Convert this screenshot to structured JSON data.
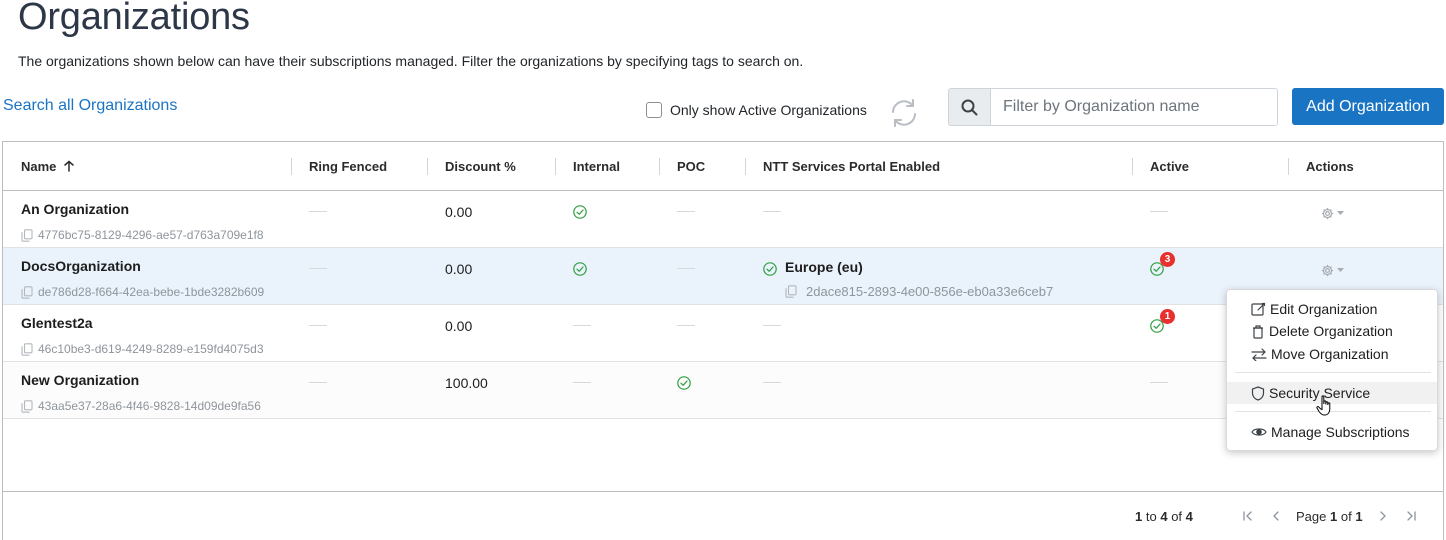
{
  "page": {
    "title": "Organizations",
    "description": "The organizations shown below can have their subscriptions managed. Filter the organizations by specifying tags to search on."
  },
  "toolbar": {
    "search_all_link": "Search all Organizations",
    "active_only_label": "Only show Active Organizations",
    "active_only_checked": false,
    "filter_placeholder": "Filter by Organization name",
    "add_button": "Add Organization"
  },
  "grid": {
    "columns": [
      "Name",
      "Ring Fenced",
      "Discount %",
      "Internal",
      "POC",
      "NTT Services Portal Enabled",
      "Active",
      "Actions"
    ],
    "sort": {
      "column": "Name",
      "direction": "ascending"
    },
    "rows": [
      {
        "name": "An Organization",
        "id": "4776bc75-8129-4296-ae57-d763a709e1f8",
        "ring_fenced": false,
        "discount": "0.00",
        "internal": true,
        "poc": false,
        "portal_region": "",
        "portal_id": "",
        "active": false,
        "active_badge": ""
      },
      {
        "name": "DocsOrganization",
        "id": "de786d28-f664-42ea-bebe-1bde3282b609",
        "ring_fenced": false,
        "discount": "0.00",
        "internal": true,
        "poc": false,
        "portal_region": "Europe (eu)",
        "portal_id": "2dace815-2893-4e00-856e-eb0a33e6ceb7",
        "active": true,
        "active_badge": "3"
      },
      {
        "name": "Glentest2a",
        "id": "46c10be3-d619-4249-8289-e159fd4075d3",
        "ring_fenced": false,
        "discount": "0.00",
        "internal": false,
        "poc": false,
        "portal_region": "",
        "portal_id": "",
        "active": true,
        "active_badge": "1"
      },
      {
        "name": "New Organization",
        "id": "43aa5e37-28a6-4f46-9828-14d09de9fa56",
        "ring_fenced": false,
        "discount": "100.00",
        "internal": false,
        "poc": true,
        "portal_region": "",
        "portal_id": "",
        "active": false,
        "active_badge": ""
      }
    ]
  },
  "pagination": {
    "range_start": "1",
    "range_to": "to",
    "range_end": "4",
    "range_of": "of",
    "total": "4",
    "page_label": "Page",
    "page_current": "1",
    "page_of": "of",
    "page_total": "1"
  },
  "actions_menu": {
    "items": [
      "Edit Organization",
      "Delete Organization",
      "Move Organization",
      "Security Service",
      "Manage Subscriptions"
    ],
    "hovered": "Security Service"
  },
  "colors": {
    "primary": "#1a74c4",
    "success": "#2e9e3e",
    "badge": "#e8312f",
    "row_highlight": "#eaf2fb"
  },
  "icons": [
    "search-icon",
    "refresh-icon",
    "sort-ascending-icon",
    "copy-icon",
    "check-circle-icon",
    "gear-icon",
    "caret-down-icon",
    "edit-icon",
    "trash-icon",
    "swap-icon",
    "shield-icon",
    "eye-icon",
    "first-page-icon",
    "prev-page-icon",
    "next-page-icon",
    "last-page-icon",
    "hand-cursor-icon"
  ]
}
